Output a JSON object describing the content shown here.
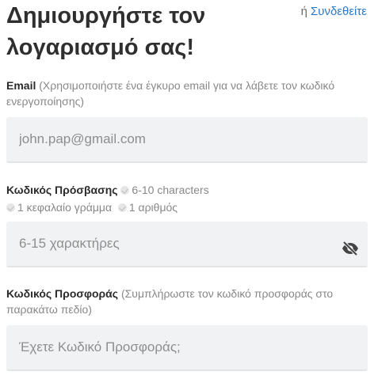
{
  "header": {
    "title": "Δημιουργήστε τον λογαριασμό σας!",
    "or_text": "ή",
    "login_link": "Συνδεθείτε"
  },
  "email": {
    "label": "Email",
    "hint": "(Χρησιμοποιήστε ένα έγκυρο email για να λάβετε τον κωδικό ενεργοποίησης)",
    "value": "",
    "placeholder": "john.pap@gmail.com"
  },
  "password": {
    "label": "Κωδικός Πρόσβασης",
    "requirements": [
      "6-10 characters",
      "1 κεφαλαίο γράμμα",
      "1 αριθμός"
    ],
    "value": "",
    "placeholder": "6-15 χαρακτήρες",
    "toggle_icon": "eye-slash-icon"
  },
  "promo": {
    "label": "Κωδικός Προσφοράς",
    "hint": "(Συμπλήρωστε τον κωδικό προσφοράς στο παρακάτω πεδίο)",
    "value": "",
    "placeholder": "Έχετε Κωδικό Προσφοράς;"
  },
  "colors": {
    "link": "#2a78c7",
    "input_bg": "#f1f2f3",
    "title": "#2f2f2f"
  }
}
